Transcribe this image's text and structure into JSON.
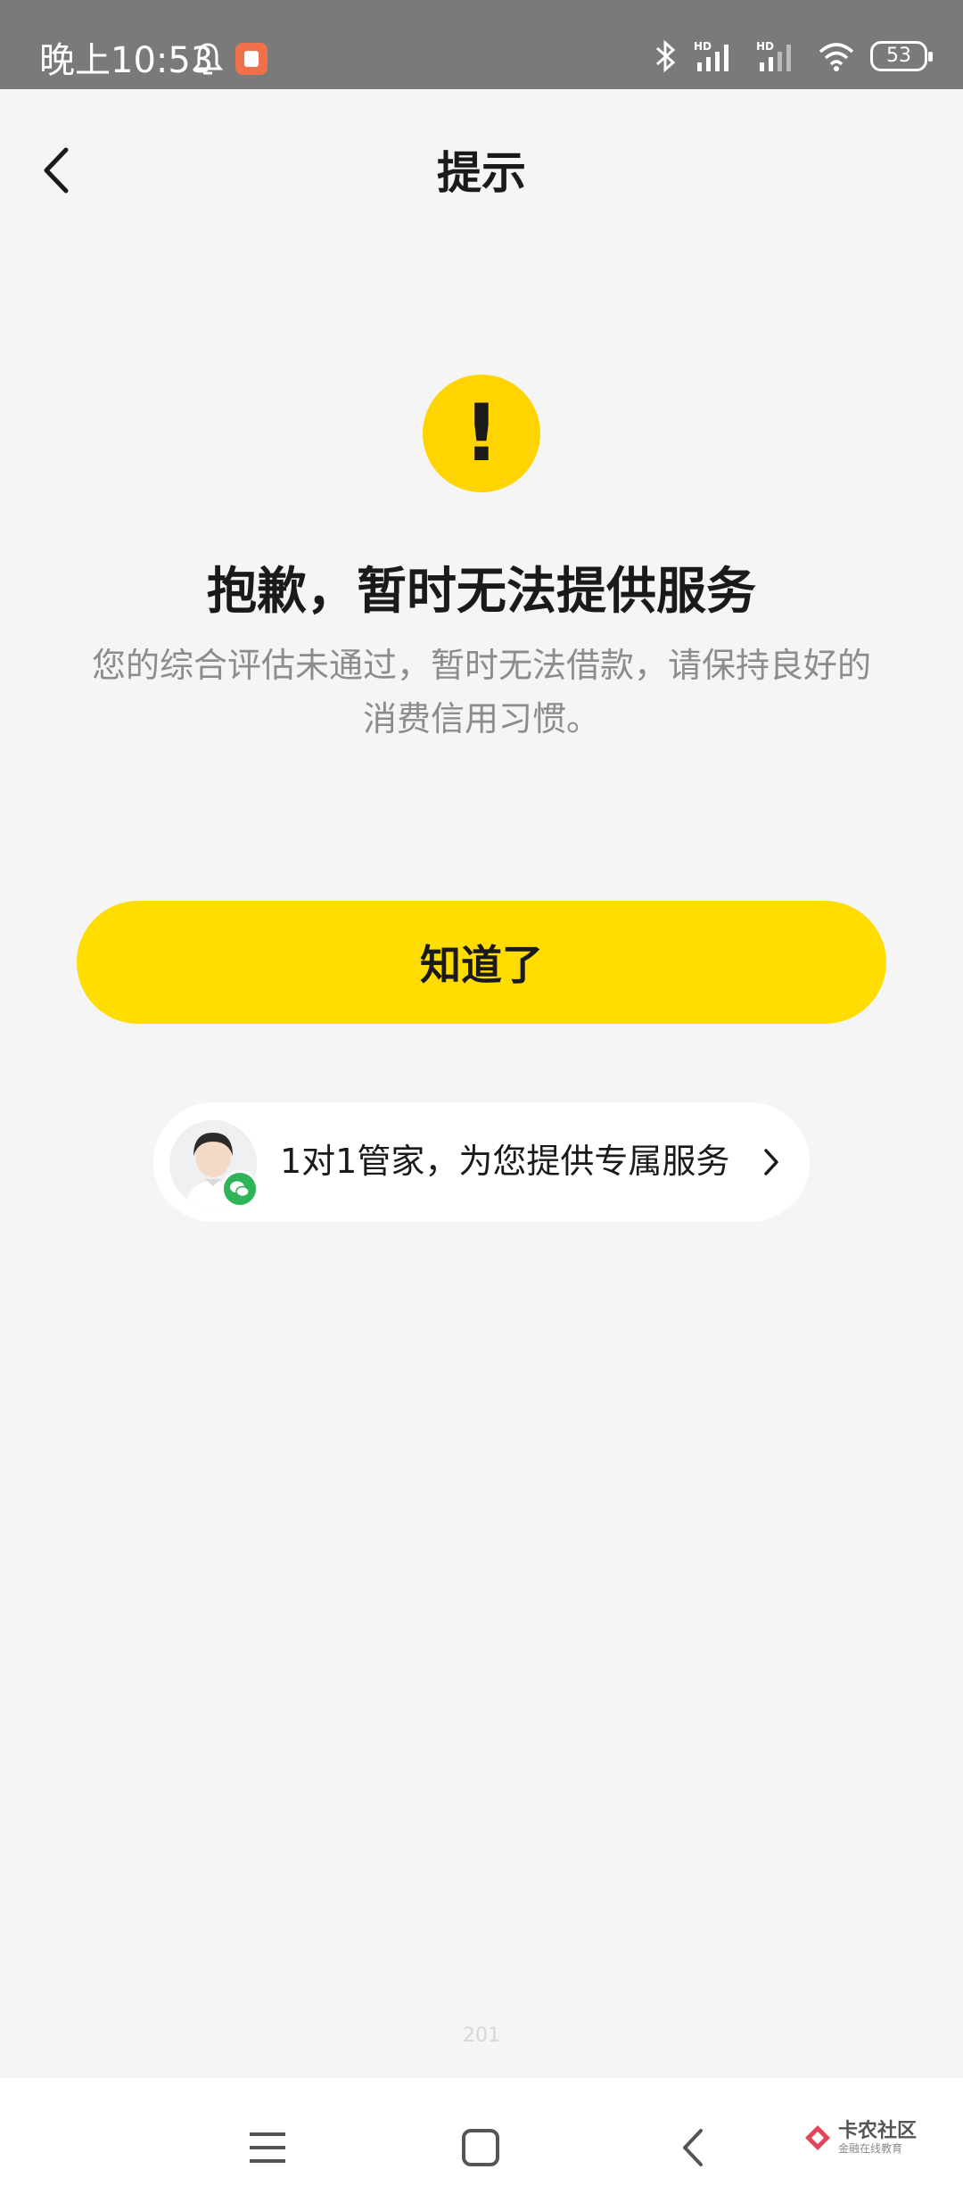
{
  "status_bar": {
    "time": "晚上10:53",
    "battery": "53"
  },
  "header": {
    "title": "提示"
  },
  "alert": {
    "icon_glyph": "!",
    "title": "抱歉，暂时无法提供服务",
    "description": "您的综合评估未通过，暂时无法借款，请保持良好的消费信用习惯。"
  },
  "actions": {
    "confirm_label": "知道了"
  },
  "service": {
    "text": "1对1管家，为您提供专属服务"
  },
  "footer": {
    "version": "201"
  },
  "watermark": {
    "main": "卡农社区",
    "sub": "金融在线教育"
  },
  "colors": {
    "accent": "#ffdd00",
    "status_bar": "#7a7a7a",
    "background": "#f5f5f5",
    "wechat": "#2fb457"
  }
}
